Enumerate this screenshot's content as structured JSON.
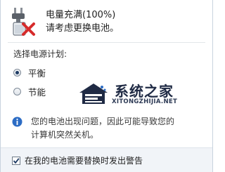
{
  "battery": {
    "icon": "battery-warning-icon",
    "status_line1": "电量充满(100%)",
    "status_line2": "请考虑更换电池。"
  },
  "power_plan": {
    "heading": "选择电源计划:",
    "options": [
      {
        "label": "平衡",
        "selected": true
      },
      {
        "label": "节能",
        "selected": false
      }
    ]
  },
  "notice": {
    "icon": "info-icon",
    "line1": "您的电池出现问题，因此可能导致您的",
    "line2": "计算机突然关机。"
  },
  "footer": {
    "checkbox_label": "在我的电池需要替换时发出警告",
    "checked": true
  },
  "watermark": {
    "title": "系统之家",
    "subtitle": "XITONGZHIJIA.NET"
  },
  "colors": {
    "accent": "#1e3b64",
    "error_red": "#d62b2b",
    "info_blue": "#2c6cc4"
  }
}
